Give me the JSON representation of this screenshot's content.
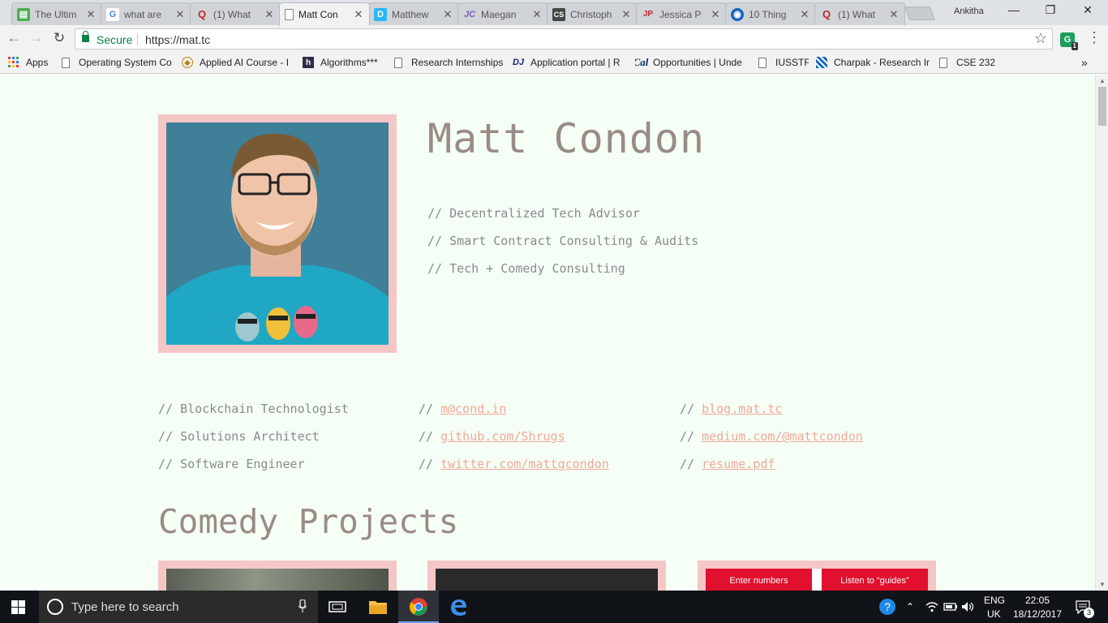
{
  "browser": {
    "tabs": [
      {
        "title": "The Ultim",
        "favicon_color": "#4caf50",
        "favicon_char": "▤"
      },
      {
        "title": "what are",
        "favicon_color": "#ffffff",
        "favicon_char": "G"
      },
      {
        "title": "(1) What",
        "favicon_color": "#ffffff",
        "favicon_char": "Q"
      },
      {
        "title": "Matt Con",
        "favicon_color": "#ffffff",
        "favicon_char": ""
      },
      {
        "title": "Matthew",
        "favicon_color": "#29b6f6",
        "favicon_char": "D"
      },
      {
        "title": "Maegan",
        "favicon_color": "#ffffff",
        "favicon_char": "JC"
      },
      {
        "title": "Christoph",
        "favicon_color": "#444444",
        "favicon_char": "CS"
      },
      {
        "title": "Jessica P",
        "favicon_color": "#ffffff",
        "favicon_char": "JP"
      },
      {
        "title": "10 Thing",
        "favicon_color": "#1565c0",
        "favicon_char": "◉"
      },
      {
        "title": "(1) What",
        "favicon_color": "#ffffff",
        "favicon_char": "Q"
      }
    ],
    "active_tab_index": 3,
    "profile_name": "Ankitha",
    "security_label": "Secure",
    "url": "https://mat.tc",
    "extension_badge": "1",
    "bookmarks": [
      {
        "label": "Apps",
        "icon": "apps-grid-icon"
      },
      {
        "label": "Operating System Co",
        "icon": "document-icon"
      },
      {
        "label": "Applied AI Course - I",
        "icon": "course-icon"
      },
      {
        "label": "Algorithms***",
        "icon": "hackerrank-icon"
      },
      {
        "label": "Research Internships",
        "icon": "document-icon"
      },
      {
        "label": "Application portal | R",
        "icon": "dj-icon"
      },
      {
        "label": "Opportunities | Unde",
        "icon": "berkeley-icon"
      },
      {
        "label": "IUSSTF",
        "icon": "document-icon"
      },
      {
        "label": "Charpak - Research Ir",
        "icon": "charpak-icon"
      },
      {
        "label": "CSE 232",
        "icon": "document-icon"
      }
    ],
    "bookmarks_overflow": "»"
  },
  "page": {
    "name": "Matt Condon",
    "roles": [
      "// Decentralized Tech Advisor",
      "// Smart Contract Consulting & Audits",
      "// Tech + Comedy Consulting"
    ],
    "skills": [
      "// Blockchain Technologist",
      "// Solutions Architect",
      "// Software Engineer"
    ],
    "link_prefix": "// ",
    "links_col1": [
      "m@cond.in",
      "github.com/Shrugs",
      "twitter.com/mattgcondon"
    ],
    "links_col2": [
      "blog.mat.tc",
      "medium.com/@mattcondon",
      "resume.pdf"
    ],
    "section_title": "Comedy Projects",
    "thumb3_buttons": [
      "Enter numbers",
      "Listen to “guides”"
    ]
  },
  "taskbar": {
    "search_placeholder": "Type here to search",
    "lang_top": "ENG",
    "lang_bottom": "UK",
    "time": "22:05",
    "date": "18/12/2017",
    "notification_count": "3"
  },
  "colors": {
    "page_bg": "#f5fff6",
    "frame_pink": "#f5c6c6",
    "link": "#f2a895",
    "heading": "#998c85"
  }
}
